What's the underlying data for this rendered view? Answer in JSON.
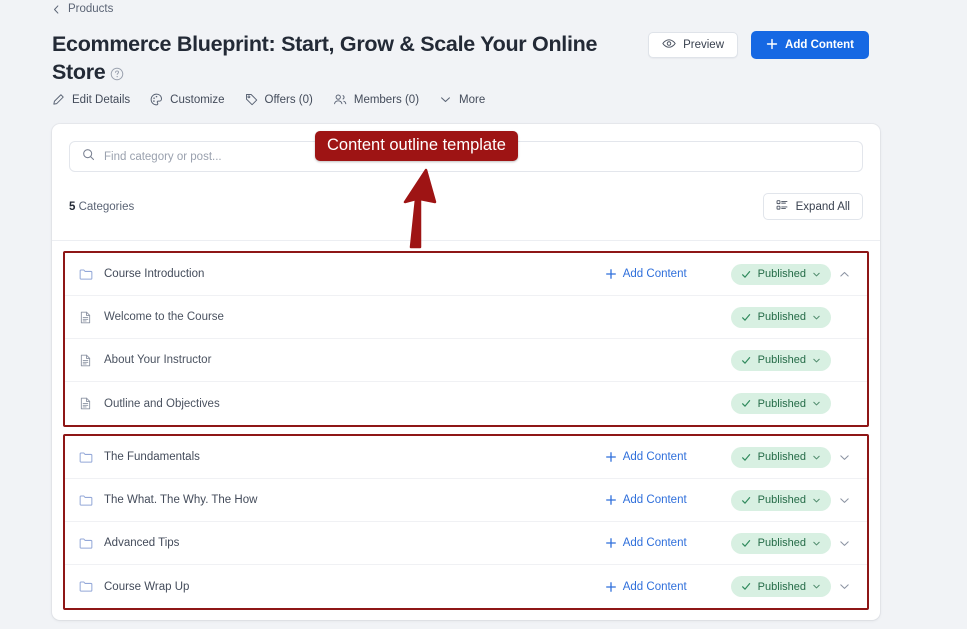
{
  "breadcrumb": {
    "label": "Products",
    "icon": "chevron-left-icon"
  },
  "header": {
    "title": "Ecommerce Blueprint: Start, Grow & Scale Your Online Store",
    "help_icon": "question-circle-icon",
    "preview_label": "Preview",
    "preview_icon": "eye-icon",
    "add_content_label": "Add Content",
    "add_content_icon": "plus-icon",
    "accent_color": "#1668e3"
  },
  "tabs": [
    {
      "label": "Edit Details",
      "icon": "pencil-icon"
    },
    {
      "label": "Customize",
      "icon": "palette-icon"
    },
    {
      "label": "Offers (0)",
      "icon": "tag-icon"
    },
    {
      "label": "Members (0)",
      "icon": "people-icon"
    },
    {
      "label": "More",
      "icon": "chevron-down-icon"
    }
  ],
  "search": {
    "placeholder": "Find category or post...",
    "value": "",
    "icon": "search-icon"
  },
  "toolbar": {
    "count_number": "5",
    "count_label": " Categories",
    "expand_all_label": "Expand All",
    "expand_all_icon": "list-icon"
  },
  "labels": {
    "add_content": "Add Content",
    "published": "Published"
  },
  "annotation": {
    "text": "Content outline template",
    "color": "#9e1414",
    "arrow": "up-arrow-annotation"
  },
  "groups": [
    {
      "expanded": true,
      "category": {
        "title": "Course Introduction",
        "icon": "folder-icon",
        "status": "Published",
        "add_content": "Add Content",
        "chevron": "chevron-up-icon"
      },
      "items": [
        {
          "title": "Welcome to the Course",
          "icon": "document-icon",
          "status": "Published"
        },
        {
          "title": "About Your Instructor",
          "icon": "document-icon",
          "status": "Published"
        },
        {
          "title": "Outline and Objectives",
          "icon": "document-icon",
          "status": "Published"
        }
      ]
    },
    {
      "expanded": false,
      "categories": [
        {
          "title": "The Fundamentals",
          "icon": "folder-icon",
          "status": "Published",
          "add_content": "Add Content",
          "chevron": "chevron-down-icon"
        },
        {
          "title": "The What. The Why. The How",
          "icon": "folder-icon",
          "status": "Published",
          "add_content": "Add Content",
          "chevron": "chevron-down-icon"
        },
        {
          "title": "Advanced Tips",
          "icon": "folder-icon",
          "status": "Published",
          "add_content": "Add Content",
          "chevron": "chevron-down-icon"
        },
        {
          "title": "Course Wrap Up",
          "icon": "folder-icon",
          "status": "Published",
          "add_content": "Add Content",
          "chevron": "chevron-down-icon"
        }
      ]
    }
  ]
}
